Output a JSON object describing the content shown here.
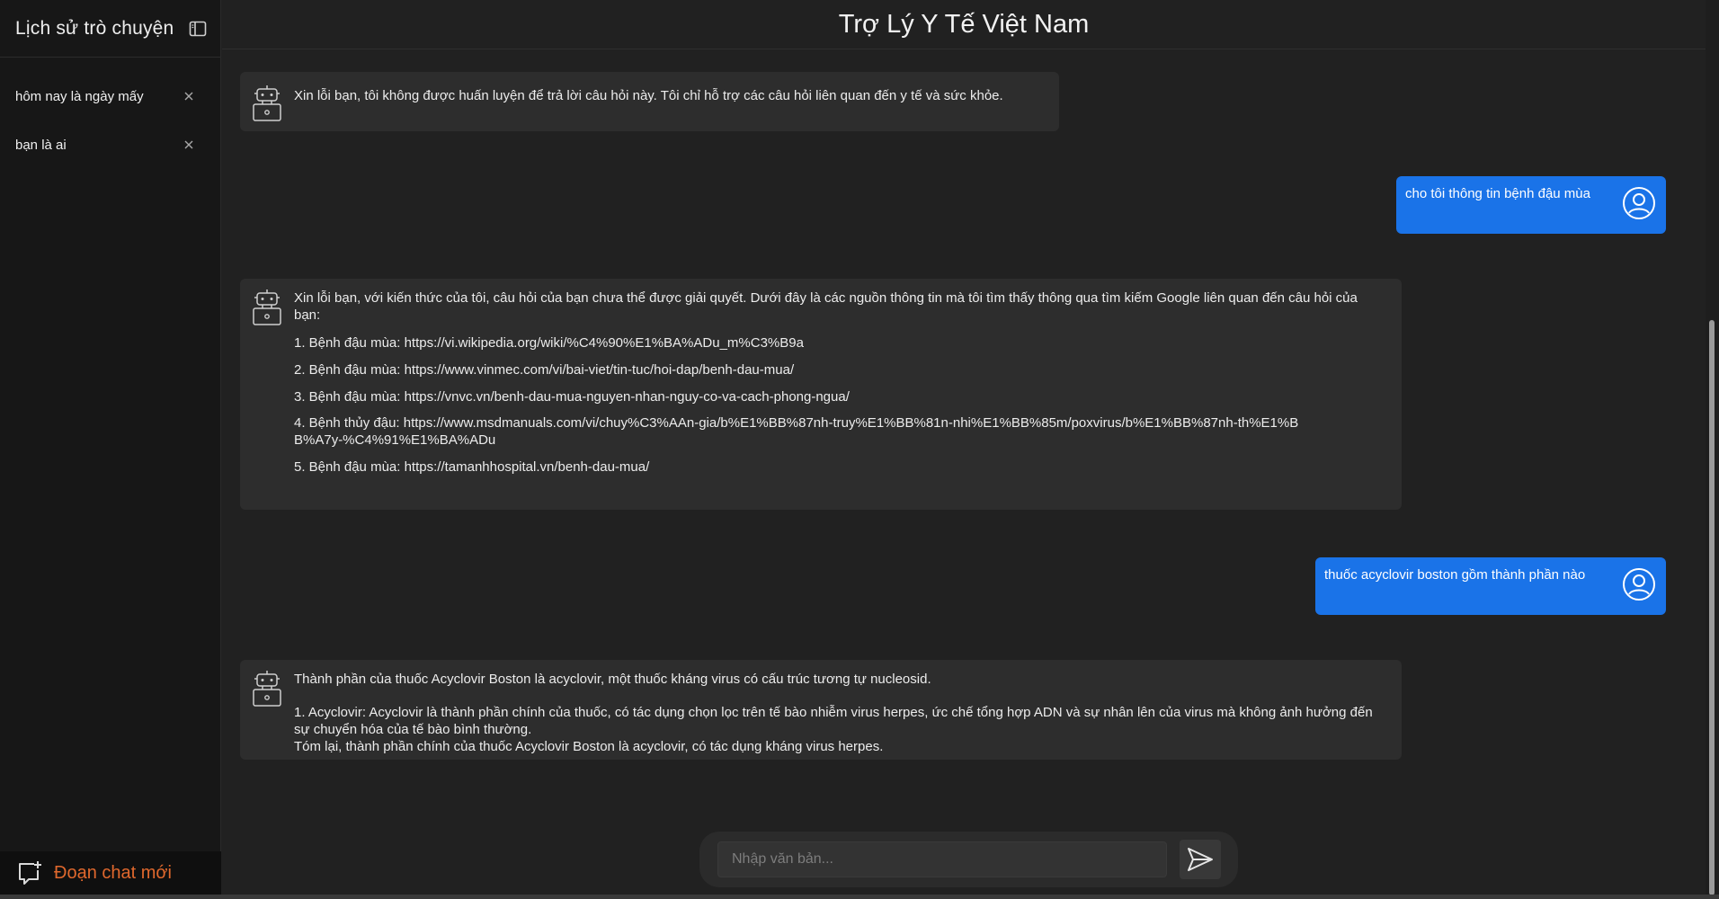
{
  "sidebar": {
    "title": "Lịch sử trò chuyện",
    "toggle_icon": "sidebar-toggle-icon",
    "items": [
      {
        "label": "hôm nay là ngày mấy"
      },
      {
        "label": "bạn là ai"
      }
    ],
    "new_chat_label": "Đoạn chat mới",
    "new_chat_color": "#e0682d"
  },
  "header": {
    "title": "Trợ Lý Y Tế Việt Nam"
  },
  "messages": {
    "m1": {
      "text": "Xin lỗi bạn, tôi không được huấn luyện để trả lời câu hỏi này. Tôi chỉ hỗ trợ các câu hỏi liên quan đến y tế và sức khỏe."
    },
    "m2": {
      "text": "cho tôi thông tin bệnh đậu mùa"
    },
    "m3": {
      "intro": "Xin lỗi bạn, với kiến thức của tôi, câu hỏi của bạn chưa thể được giải quyết. Dưới đây là các nguồn thông tin mà tôi tìm thấy thông qua tìm kiếm Google liên quan đến câu hỏi của bạn:",
      "items": [
        "1. Bệnh đậu mùa: https://vi.wikipedia.org/wiki/%C4%90%E1%BA%ADu_m%C3%B9a",
        "2. Bệnh đậu mùa: https://www.vinmec.com/vi/bai-viet/tin-tuc/hoi-dap/benh-dau-mua/",
        "3. Bệnh đậu mùa: https://vnvc.vn/benh-dau-mua-nguyen-nhan-nguy-co-va-cach-phong-ngua/",
        "4. Bệnh thủy đậu: https://www.msdmanuals.com/vi/chuy%C3%AAn-gia/b%E1%BB%87nh-truy%E1%BB%81n-nhi%E1%BB%85m/poxvirus/b%E1%BB%87nh-th%E1%BB%A7y-%C4%91%E1%BA%ADu",
        "5. Bệnh đậu mùa: https://tamanhhospital.vn/benh-dau-mua/"
      ]
    },
    "m4": {
      "text": "thuốc acyclovir boston gồm thành phần nào"
    },
    "m5": {
      "intro": "Thành phần của thuốc Acyclovir Boston là acyclovir, một thuốc kháng virus có cấu trúc tương tự nucleosid.",
      "item": "1.  Acyclovir: Acyclovir là thành phần chính của thuốc, có tác dụng chọn lọc trên tế bào nhiễm virus herpes, ức chế tổng hợp ADN và sự nhân lên của virus mà không ảnh hưởng đến sự chuyển hóa của tế bào bình thường.",
      "summary": "Tóm lại, thành phần chính của thuốc Acyclovir Boston là acyclovir, có tác dụng kháng virus herpes."
    }
  },
  "input": {
    "placeholder": "Nhập văn bản...",
    "value": ""
  },
  "colors": {
    "user_bubble": "#1a73e8",
    "bot_bubble": "#2d2d2d",
    "background": "#212121",
    "sidebar": "#171717"
  }
}
